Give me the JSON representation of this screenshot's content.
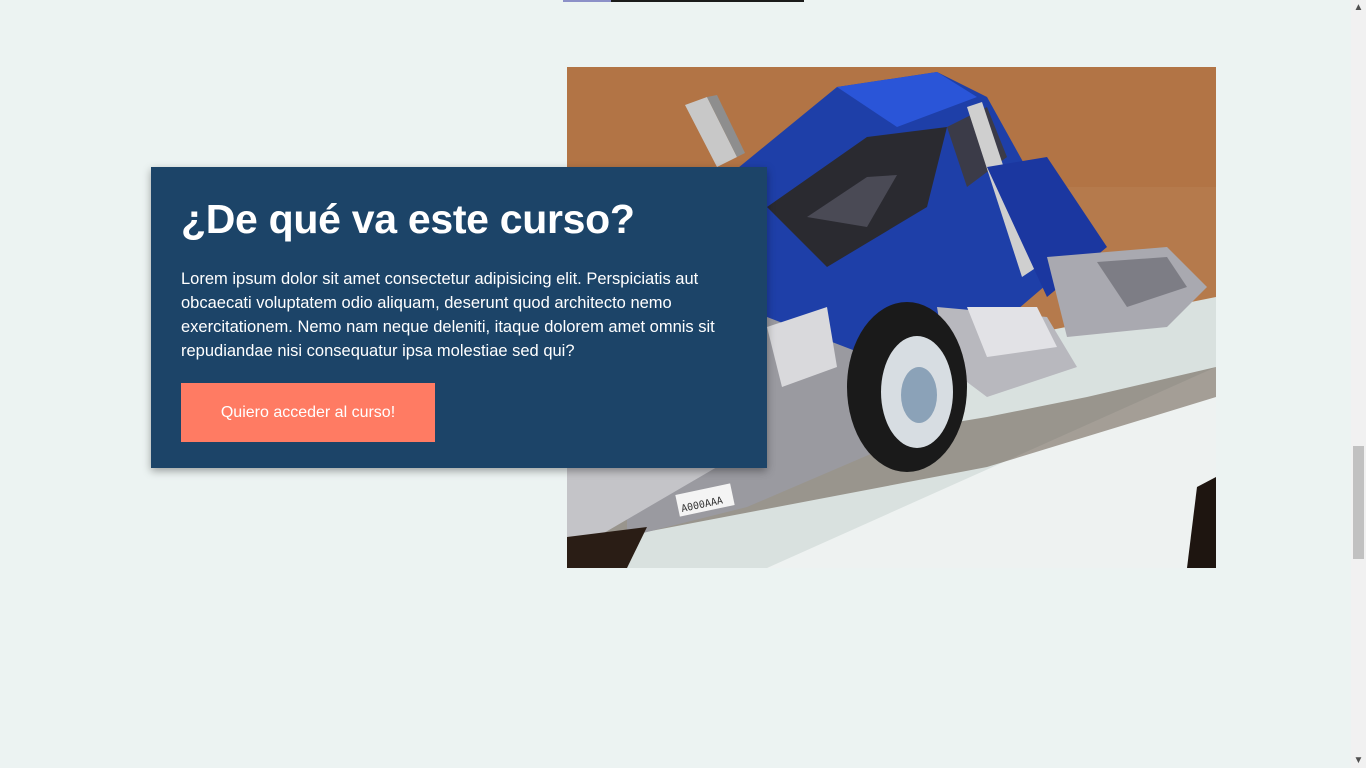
{
  "course_section": {
    "title": "¿De qué va este curso?",
    "description": "Lorem ipsum dolor sit amet consectetur adipisicing elit. Perspiciatis aut obcaecati voluptatem odio aliquam, deserunt quod architecto nemo exercitationem. Nemo nam neque deleniti, itaque dolorem amet omnis sit repudiandae nisi consequatur ipsa molestiae sed qui?",
    "cta_label": "Quiero acceder al curso!",
    "image_subject": "blue toy semi truck"
  },
  "photo": {
    "plate_text": "A000AAA"
  },
  "colors": {
    "background": "#ecf3f2",
    "card": "#1c4468",
    "cta": "#ff7b63",
    "text": "#ffffff"
  },
  "scrollbar": {
    "up_icon": "▲",
    "down_icon": "▼"
  }
}
